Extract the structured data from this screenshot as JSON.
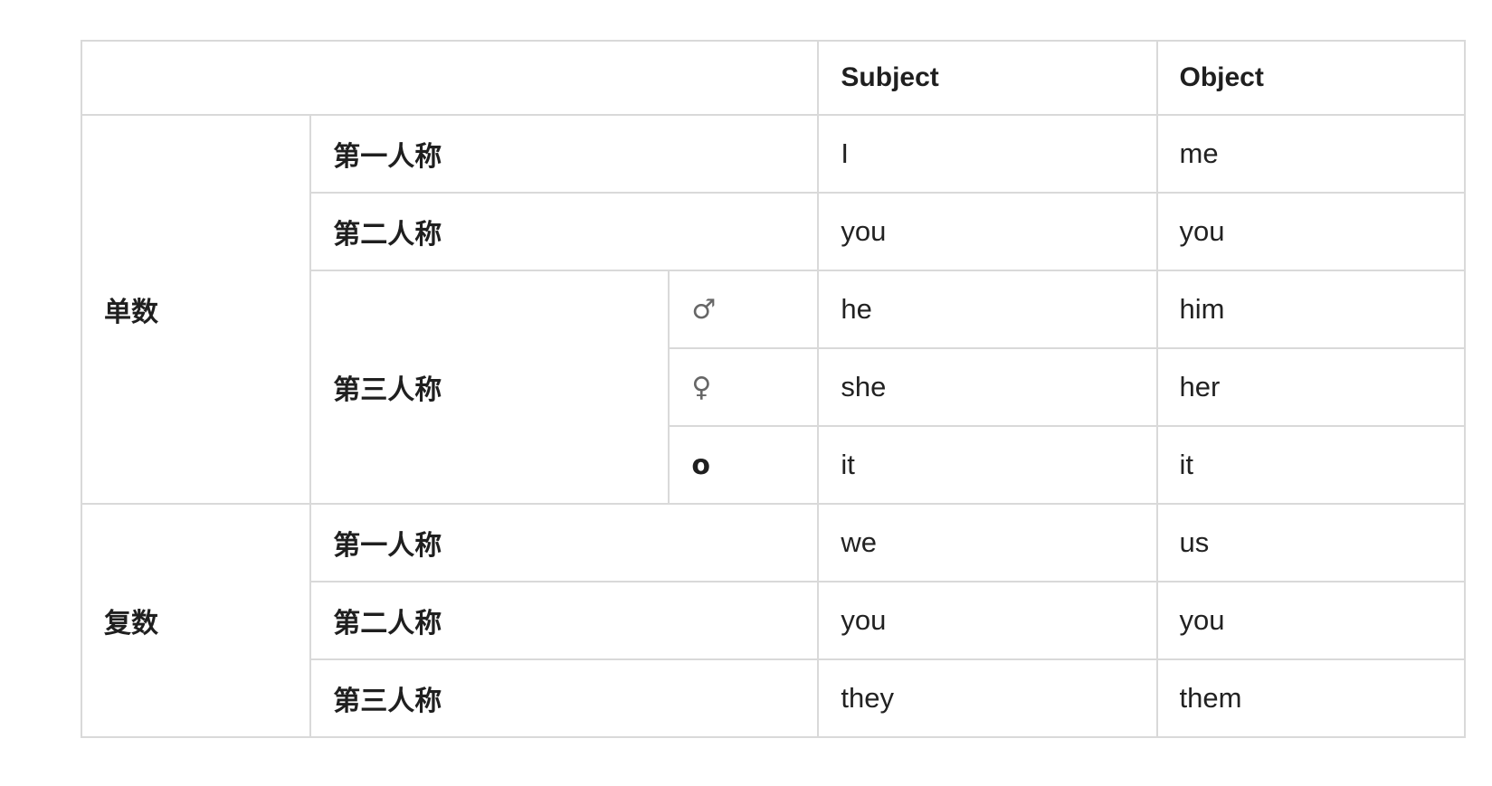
{
  "table": {
    "headers": {
      "corner": "",
      "subject": "Subject",
      "object": "Object"
    },
    "singular": {
      "label": "单数",
      "first": {
        "label": "第一人称",
        "subject": "I",
        "object": "me"
      },
      "second": {
        "label": "第二人称",
        "subject": "you",
        "object": "you"
      },
      "third": {
        "label": "第三人称",
        "masculine": {
          "symbol": "♂",
          "subject": "he",
          "object": "him"
        },
        "feminine": {
          "symbol": "♀",
          "subject": "she",
          "object": "her"
        },
        "neuter": {
          "symbol": "o",
          "subject": "it",
          "object": "it"
        }
      }
    },
    "plural": {
      "label": "复数",
      "first": {
        "label": "第一人称",
        "subject": "we",
        "object": "us"
      },
      "second": {
        "label": "第二人称",
        "subject": "you",
        "object": "you"
      },
      "third": {
        "label": "第三人称",
        "subject": "they",
        "object": "them"
      }
    }
  }
}
